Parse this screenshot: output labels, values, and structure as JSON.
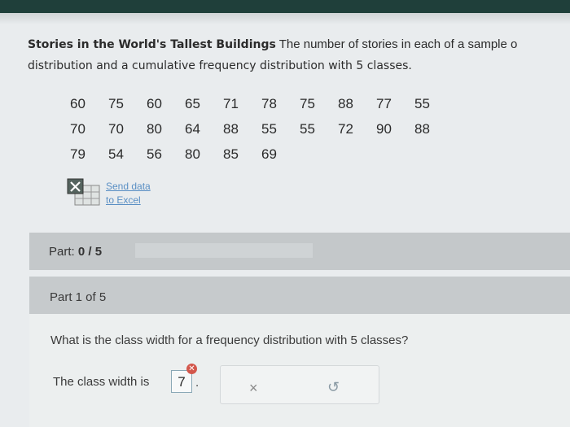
{
  "problem": {
    "title": "Stories in the World's Tallest Buildings",
    "text_line1": " The number of stories in each of a sample o",
    "text_line2": "distribution and a cumulative frequency distribution with 5 classes."
  },
  "data_rows": [
    [
      "60",
      "75",
      "60",
      "65",
      "71",
      "78",
      "75",
      "88",
      "77",
      "55"
    ],
    [
      "70",
      "70",
      "80",
      "64",
      "88",
      "55",
      "55",
      "72",
      "90",
      "88"
    ],
    [
      "79",
      "54",
      "56",
      "80",
      "85",
      "69",
      "",
      "",
      "",
      ""
    ]
  ],
  "excel_link": {
    "line1": "Send data",
    "line2": "to Excel",
    "icon": "excel-icon"
  },
  "progress": {
    "label": "Part:",
    "value": "0 / 5",
    "fraction": 0
  },
  "part_header": "Part 1 of 5",
  "question": "What is the class width for a frequency distribution with 5 classes?",
  "answer": {
    "prefix": "The class width is",
    "value": "7",
    "suffix": ".",
    "status_icon": "incorrect-x-icon"
  },
  "tools": {
    "clear": "×",
    "undo": "↺"
  }
}
